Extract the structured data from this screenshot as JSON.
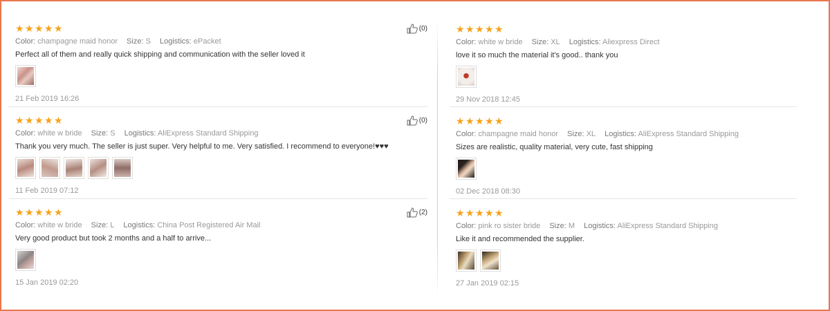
{
  "labels": {
    "color": "Color:",
    "size": "Size:",
    "logistics": "Logistics:"
  },
  "star_color": "#f7a21a",
  "left": [
    {
      "rating": 5,
      "color": "champagne maid honor",
      "size": "S",
      "logistics": "ePacket",
      "text": "Perfect all of them and really quick shipping and communication with the seller loved it",
      "images": [
        "photo-pink-dress"
      ],
      "date": "21 Feb 2019 16:26",
      "helpful": "(0)"
    },
    {
      "rating": 5,
      "color": "white w bride",
      "size": "S",
      "logistics": "AliExpress Standard Shipping",
      "text": "Thank you very much. The seller is just super. Very helpful to me. Very satisfied. I recommend to everyone!♥♥♥",
      "images": [
        "photo-package-1",
        "photo-package-2",
        "photo-package-3",
        "photo-package-4",
        "photo-package-5"
      ],
      "date": "11 Feb 2019 07:12",
      "helpful": "(0)"
    },
    {
      "rating": 5,
      "color": "white w bride",
      "size": "L",
      "logistics": "China Post Registered Air Mail",
      "text": "Very good product but took 2 months and a half to arrive...",
      "images": [
        "photo-package-grey"
      ],
      "date": "15 Jan 2019 02:20",
      "helpful": "(2)"
    }
  ],
  "right": [
    {
      "rating": 5,
      "color": "white w bride",
      "size": "XL",
      "logistics": "Aliexpress Direct",
      "text": "love it so much the material it's good.. thank you",
      "images": [
        "photo-red-text-shirt"
      ],
      "date": "29 Nov 2018 12:45"
    },
    {
      "rating": 5,
      "color": "champagne maid honor",
      "size": "XL",
      "logistics": "AliExpress Standard Shipping",
      "text": "Sizes are realistic, quality material, very cute, fast shipping",
      "images": [
        "photo-dark-items"
      ],
      "date": "02 Dec 2018 08:30"
    },
    {
      "rating": 5,
      "color": "pink ro sister bride",
      "size": "M",
      "logistics": "AliExpress Standard Shipping",
      "text": "Like it and recommended the supplier.",
      "images": [
        "photo-items-1",
        "photo-items-2"
      ],
      "date": "27 Jan 2019 02:15"
    }
  ]
}
